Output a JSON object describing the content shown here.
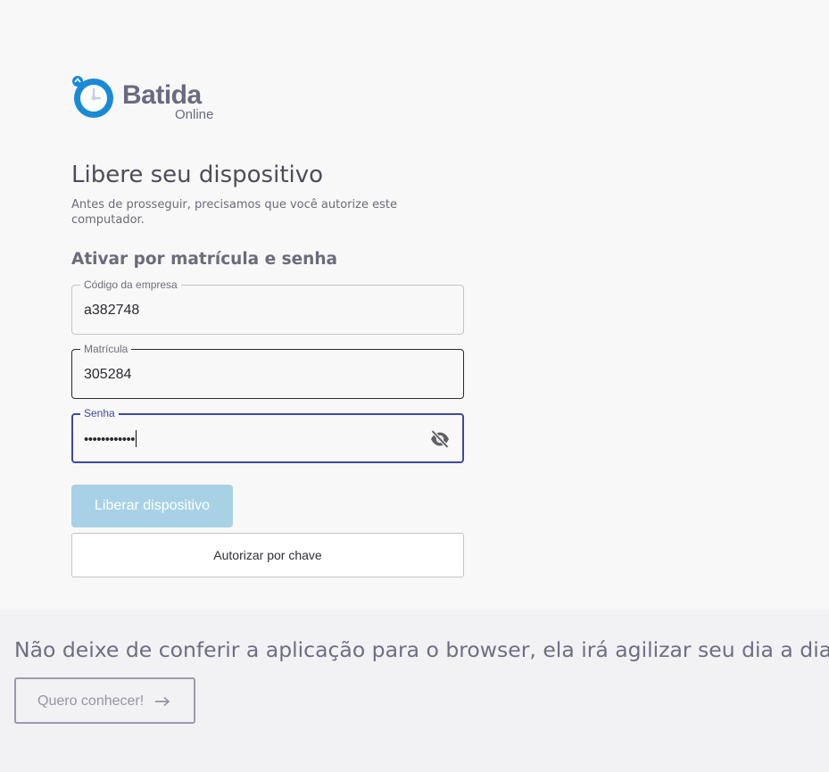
{
  "brand": {
    "name": "Batida",
    "sub": "Online",
    "primary_color": "#1a8ad6",
    "text_color": "#6a6a80"
  },
  "heading": {
    "title": "Libere seu dispositivo",
    "subtitle": "Antes de prosseguir, precisamos que você autorize este computador."
  },
  "section": {
    "label": "Ativar por matrícula e senha"
  },
  "fields": {
    "company": {
      "label": "Código da empresa",
      "value": "a382748"
    },
    "registration": {
      "label": "Matrícula",
      "value": "305284"
    },
    "password": {
      "label": "Senha",
      "value": "••••••••••••",
      "toggle_icon": "eye-off-icon"
    }
  },
  "buttons": {
    "release": "Liberar dispositivo",
    "authorize_key": "Autorizar por chave"
  },
  "promo": {
    "text": "Não deixe de conferir a aplicação para o browser, ela irá agilizar seu dia a dia!",
    "button": "Quero conhecer!",
    "button_icon": "arrow-right-icon"
  },
  "colors": {
    "focus": "#3f48a8",
    "primary_button_disabled": "#a8d1e6"
  }
}
